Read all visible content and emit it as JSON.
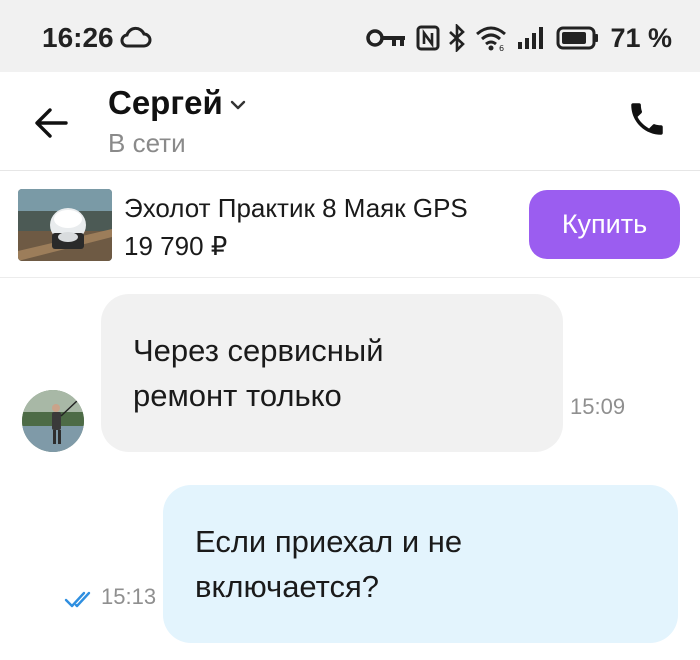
{
  "status_bar": {
    "time": "16:26",
    "battery": "71 %",
    "icons": [
      "cloud-icon",
      "key-icon",
      "nfc-icon",
      "bluetooth-icon",
      "wifi-icon",
      "signal-icon",
      "battery-icon"
    ]
  },
  "header": {
    "contact_name": "Сергей",
    "contact_status": "В сети",
    "icons": [
      "arrow-left-icon",
      "chevron-down-icon",
      "phone-icon"
    ]
  },
  "product": {
    "title": "Эхолот Практик 8 Маяк GPS",
    "price": "19 790 ₽",
    "buy_label": "Купить"
  },
  "messages": [
    {
      "direction": "incoming",
      "text_lines": [
        "Через сервисный",
        "ремонт только"
      ],
      "time": "15:09"
    },
    {
      "direction": "outgoing",
      "text_lines": [
        "Если приехал и не",
        "включается?"
      ],
      "time": "15:13",
      "status": "read"
    }
  ],
  "colors": {
    "accent": "#9b5df0",
    "incoming_bubble": "#f1f1f1",
    "outgoing_bubble": "#e3f4fd",
    "read_check": "#2f8fe0",
    "status_bar_bg": "#f1f1f1"
  }
}
